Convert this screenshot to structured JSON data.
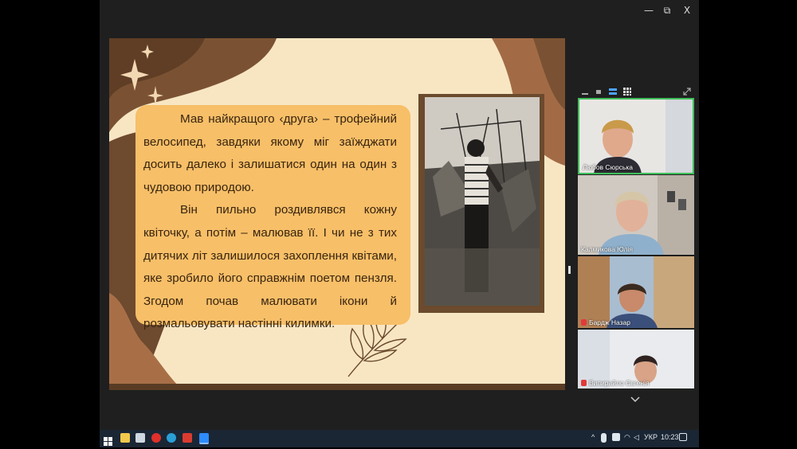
{
  "window": {
    "minimize": "—",
    "restore": "⧉",
    "close": "X"
  },
  "slide": {
    "paragraph1": "Мав найкращого ‹друга› – трофейний велосипед, завдяки якому міг заїжджати досить далеко і залишатися один на один з чудовою природою.",
    "paragraph2": "Він пильно роздивлявся кожну квіточку, а потім – малював її. І чи не з тих дитячих літ залишилося захоплення квітами, яке зробило його справжнім поетом пензля. Згодом почав малювати ікони й розмальовувати настінні килимки."
  },
  "participants": [
    {
      "name": "Любов Сюрська",
      "muted": false
    },
    {
      "name": "Калмикова Юлія",
      "muted": false
    },
    {
      "name": "Бардж Назар",
      "muted": true
    },
    {
      "name": "Випирайло Євгенія",
      "muted": true
    }
  ],
  "taskbar": {
    "language": "УКР",
    "time": "10:23"
  },
  "colors": {
    "slide_bg": "#f8e6c3",
    "text_box": "#f7bf68",
    "brown": "#6b4a2d",
    "active_speaker": "#3fbf5a"
  }
}
